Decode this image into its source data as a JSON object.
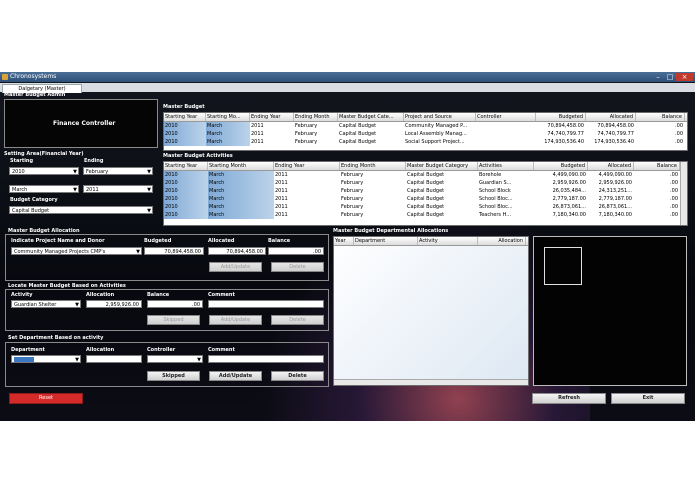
{
  "window": {
    "title": "Chronosystems"
  },
  "tab": {
    "label": "Dalgetary (Master)"
  },
  "sections": {
    "admin": "Master Budget Admin",
    "admin_role": "Finance Controller",
    "setting": "Setting Area(Financial Year)",
    "master_budget": "Master Budget",
    "activities": "Master Budget Activities",
    "allocation": "Master Budget Allocation",
    "locate": "Locate Master Budget Based on Activities",
    "set_dept": "Set Department Based on activity",
    "dept_alloc": "Master Budget Departmental Allocations"
  },
  "fy": {
    "starting_label": "Starting",
    "ending_label": "Ending",
    "start_year": "2010",
    "end_month": "February",
    "start_month": "March",
    "end_year": "2011",
    "category_label": "Budget Category",
    "category": "Capital Budget"
  },
  "master_grid": {
    "headers": [
      "Starting Year",
      "Starting Mo...",
      "Ending Year",
      "Ending Month",
      "Master Budget Cate...",
      "Project and Source",
      "Controller",
      "Budgeted",
      "Allocated",
      "Balance"
    ],
    "rows": [
      [
        "2010",
        "March",
        "2011",
        "February",
        "Capital Budget",
        "Community Managed P...",
        "",
        "70,894,458.00",
        "70,894,458.00",
        ".00"
      ],
      [
        "2010",
        "March",
        "2011",
        "February",
        "Capital Budget",
        "Local Assembly Manag...",
        "",
        "74,740,799.77",
        "74,740,799.77",
        ".00"
      ],
      [
        "2010",
        "March",
        "2011",
        "February",
        "Capital Budget",
        "Social Support Project...",
        "",
        "174,930,536.40",
        "174,930,536.40",
        ".00"
      ]
    ]
  },
  "activities_grid": {
    "headers": [
      "Starting Year",
      "Starting Month",
      "Ending Year",
      "Ending Month",
      "Master Budget Category",
      "Activities",
      "Budgeted",
      "Allocated",
      "Balance"
    ],
    "rows": [
      [
        "2010",
        "March",
        "2011",
        "February",
        "Capital Budget",
        "Borehole",
        "4,499,090.00",
        "4,499,090.00",
        ".00"
      ],
      [
        "2010",
        "March",
        "2011",
        "February",
        "Capital Budget",
        "Guardian S...",
        "2,959,926.00",
        "2,959,926.00",
        ".00"
      ],
      [
        "2010",
        "March",
        "2011",
        "February",
        "Capital Budget",
        "School Block",
        "26,035,484...",
        "24,313,251...",
        ".00"
      ],
      [
        "2010",
        "March",
        "2011",
        "February",
        "Capital Budget",
        "School Bloc...",
        "2,779,187.00",
        "2,779,187.00",
        ".00"
      ],
      [
        "2010",
        "March",
        "2011",
        "February",
        "Capital Budget",
        "School Bloc...",
        "26,873,061...",
        "26,873,061...",
        ".00"
      ],
      [
        "2010",
        "March",
        "2011",
        "February",
        "Capital Budget",
        "Teachers H...",
        "7,180,340.00",
        "7,180,340.00",
        ".00"
      ]
    ]
  },
  "alloc": {
    "project_label": "Indicate Project Name and Donor",
    "project_value": "Community Managed Projects CMP's",
    "budgeted_label": "Budgeted",
    "budgeted_value": "70,894,458.00",
    "allocated_label": "Allocated",
    "allocated_value": "70,894,458.00",
    "balance_label": "Balance",
    "balance_value": ".00",
    "add_label": "Add/Update",
    "delete_label": "Delete"
  },
  "locate": {
    "activity_label": "Activity",
    "activity_value": "Guardian Shelter",
    "allocation_label": "Allocation",
    "allocation_value": "2,959,926.00",
    "balance_label": "Balance",
    "balance_value": ".00",
    "comment_label": "Comment",
    "skipped_label": "Skipped",
    "add_label": "Add/Update",
    "delete_label": "Delete"
  },
  "dept": {
    "department_label": "Department",
    "department_value": "",
    "allocation_label": "Allocation",
    "controller_label": "Controller",
    "comment_label": "Comment",
    "skipped_label": "Skipped",
    "add_label": "Add/Update",
    "delete_label": "Delete"
  },
  "dept_grid": {
    "headers": [
      "Year",
      "Department",
      "Activity",
      "Allocation"
    ]
  },
  "footer": {
    "reset": "Reset",
    "refresh": "Refresh",
    "exit": "Exit"
  },
  "colors": {
    "reset": "#d42a2a",
    "selection": "#7fa9d6"
  }
}
